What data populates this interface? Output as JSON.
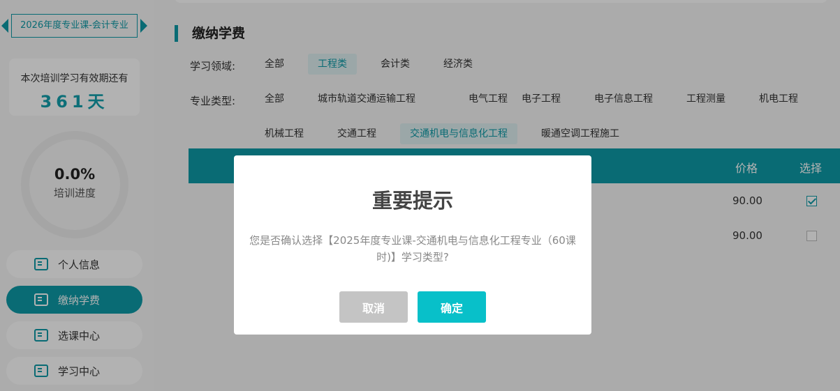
{
  "sidebar": {
    "course_name": "2026年度专业课-会计专业",
    "validity_label": "本次培训学习有效期还有",
    "validity_days": "361天",
    "progress_value": "0.0%",
    "progress_label": "培训进度",
    "nav": [
      {
        "label": "个人信息",
        "icon": "id-card-icon"
      },
      {
        "label": "缴纳学费",
        "icon": "payment-icon",
        "active": true
      },
      {
        "label": "选课中心",
        "icon": "monitor-icon"
      },
      {
        "label": "学习中心",
        "icon": "play-icon"
      }
    ]
  },
  "main": {
    "section_title": "缴纳学费",
    "field_label": "学习领域:",
    "field_options": [
      "全部",
      "工程类",
      "会计类",
      "经济类"
    ],
    "field_selected": "工程类",
    "type_label": "专业类型:",
    "type_options": [
      "全部",
      "城市轨道交通运输工程",
      "电气工程",
      "电子工程",
      "电子信息工程",
      "工程测量",
      "机电工程",
      "机械工程",
      "交通工程",
      "交通机电与信息化工程",
      "暖通空调工程施工"
    ],
    "type_selected": "交通机电与信息化工程",
    "table": {
      "headers": {
        "price": "价格",
        "select": "选择"
      },
      "rows": [
        {
          "price": "90.00",
          "checked": true
        },
        {
          "price": "90.00",
          "checked": false
        }
      ]
    }
  },
  "modal": {
    "title": "重要提示",
    "message": "您是否确认选择【2025年度专业课-交通机电与信息化工程专业（60课时)】学习类型?",
    "cancel_label": "取消",
    "confirm_label": "确定"
  },
  "colors": {
    "accent": "#0e9aa7",
    "confirm": "#08c0c9",
    "cancel": "#c4c4c4"
  }
}
